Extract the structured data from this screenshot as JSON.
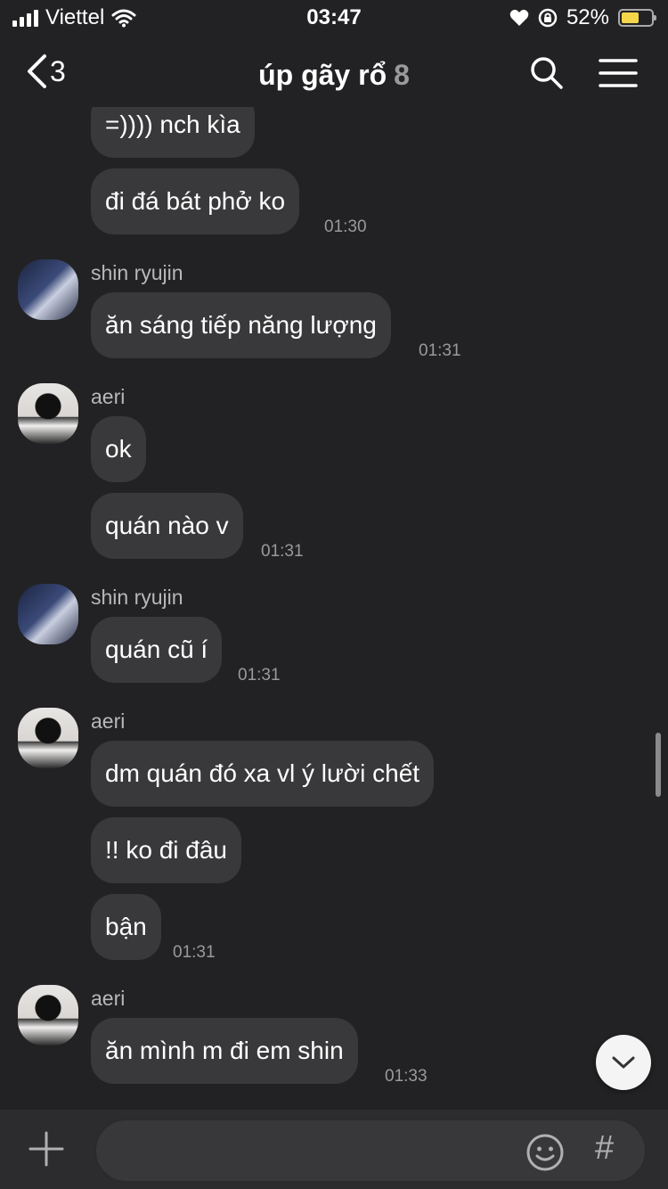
{
  "status": {
    "carrier": "Viettel",
    "time": "03:47",
    "battery": "52%"
  },
  "header": {
    "back_count": "3",
    "title": "úp gãy rổ",
    "member_count": "8"
  },
  "messages": {
    "m0": {
      "text": "=)))) nch kìa"
    },
    "m1": {
      "text": "đi đá bát phở ko",
      "time": "01:30"
    },
    "g1": {
      "name": "shin ryujin",
      "text": "ăn sáng tiếp năng lượng",
      "time": "01:31"
    },
    "g2": {
      "name": "aeri",
      "text1": "ok",
      "text2": "quán nào v",
      "time": "01:31"
    },
    "g3": {
      "name": "shin ryujin",
      "text": "quán cũ í",
      "time": "01:31"
    },
    "g4": {
      "name": "aeri",
      "text1": "dm quán đó xa vl ý lười chết",
      "text2": "!! ko đi đâu",
      "text3": "bận",
      "time": "01:31"
    },
    "g5": {
      "name": "aeri",
      "text": "ăn mình m đi em shin",
      "time": "01:33"
    }
  },
  "composer": {
    "placeholder": "",
    "hash": "#"
  },
  "colors": {
    "background": "#222224",
    "bubble": "#39393b",
    "battery": "#f5d64a"
  }
}
